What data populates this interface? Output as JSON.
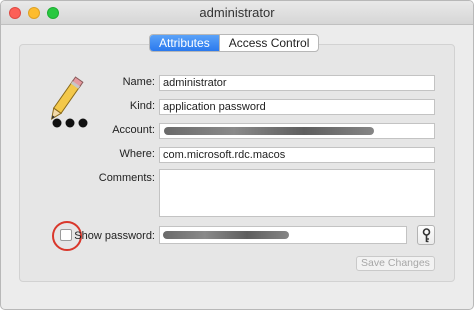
{
  "window": {
    "title": "administrator"
  },
  "tabs": [
    {
      "label": "Attributes",
      "active": true
    },
    {
      "label": "Access Control",
      "active": false
    }
  ],
  "fields": {
    "name": {
      "label": "Name:",
      "value": "administrator"
    },
    "kind": {
      "label": "Kind:",
      "value": "application password"
    },
    "account": {
      "label": "Account:",
      "value": ""
    },
    "where": {
      "label": "Where:",
      "value": "com.microsoft.rdc.macos"
    },
    "comments": {
      "label": "Comments:",
      "value": ""
    }
  },
  "show_password": {
    "label": "Show password:",
    "checked": false
  },
  "buttons": {
    "save_changes": "Save Changes"
  },
  "icons": {
    "item_icon": "pencil-with-dots-icon",
    "password_assistant": "key-icon"
  },
  "colors": {
    "accent": "#2a79ee",
    "annotation_circle": "#d9372b"
  }
}
